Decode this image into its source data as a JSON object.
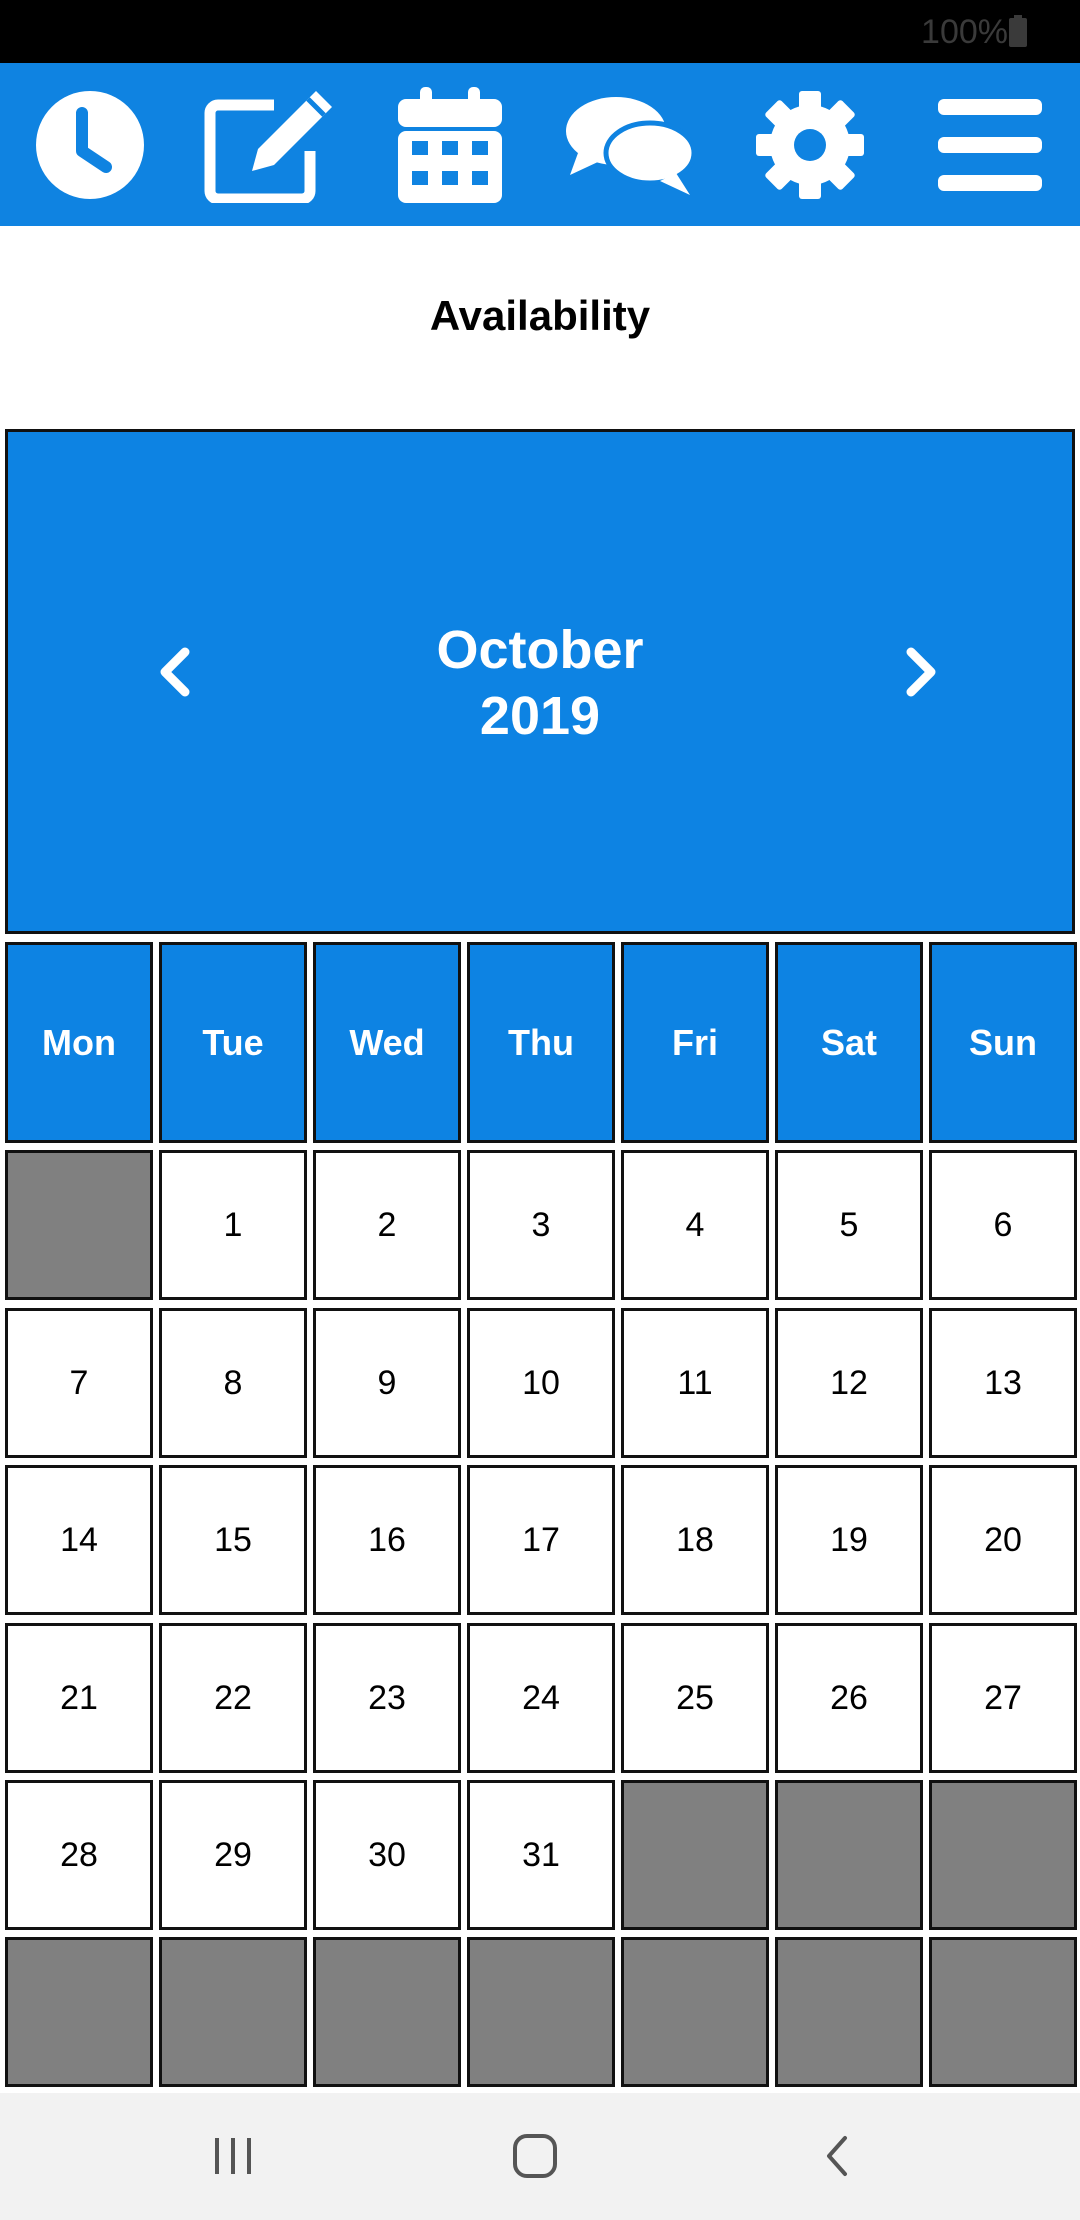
{
  "status_bar": {
    "battery_text": "100%"
  },
  "toolbar": {
    "items": [
      {
        "icon": "clock-icon"
      },
      {
        "icon": "edit-icon"
      },
      {
        "icon": "calendar-icon"
      },
      {
        "icon": "chat-icon"
      },
      {
        "icon": "gear-icon"
      },
      {
        "icon": "menu-icon"
      }
    ]
  },
  "page": {
    "title": "Availability"
  },
  "calendar": {
    "month": "October",
    "year": "2019",
    "weekdays": [
      "Mon",
      "Tue",
      "Wed",
      "Thu",
      "Fri",
      "Sat",
      "Sun"
    ],
    "weeks": [
      [
        "",
        "1",
        "2",
        "3",
        "4",
        "5",
        "6"
      ],
      [
        "7",
        "8",
        "9",
        "10",
        "11",
        "12",
        "13"
      ],
      [
        "14",
        "15",
        "16",
        "17",
        "18",
        "19",
        "20"
      ],
      [
        "21",
        "22",
        "23",
        "24",
        "25",
        "26",
        "27"
      ],
      [
        "28",
        "29",
        "30",
        "31",
        "",
        "",
        ""
      ],
      [
        "",
        "",
        "",
        "",
        "",
        "",
        ""
      ]
    ]
  },
  "colors": {
    "toolbar_bg": "#0f83e1",
    "header_bg": "#0d83e3",
    "empty_cell": "#808080"
  }
}
